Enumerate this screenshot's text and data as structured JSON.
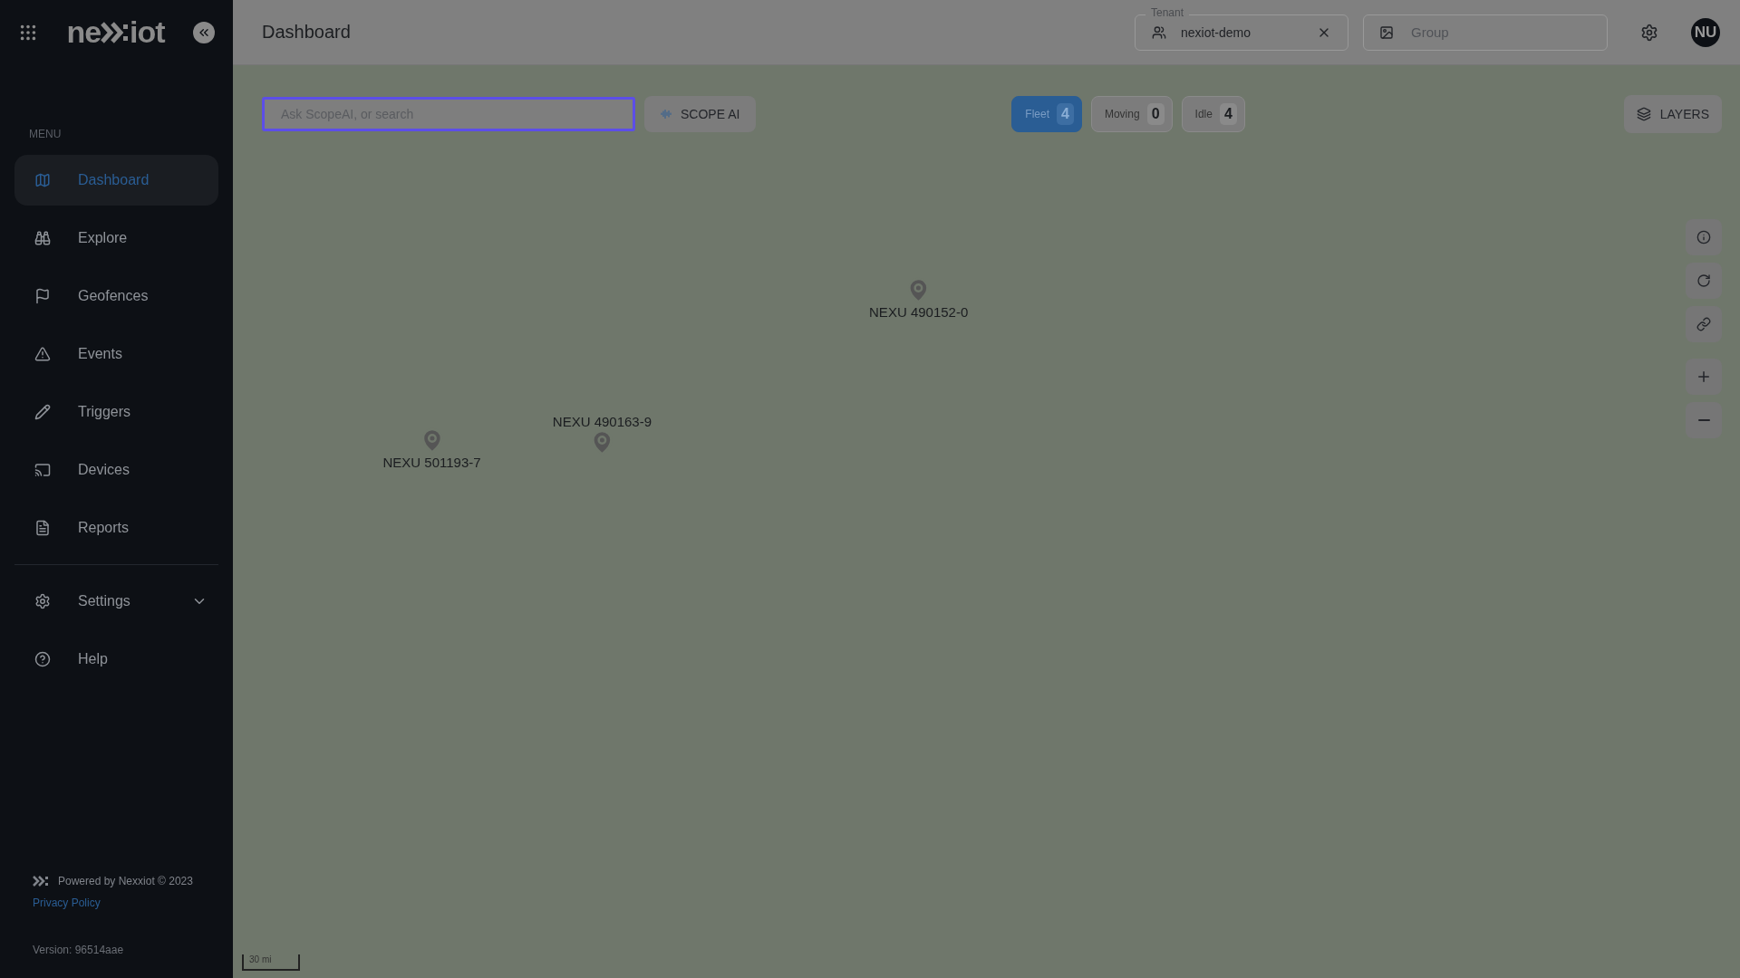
{
  "logo": {
    "start": "ne",
    "end": "iot"
  },
  "sidebar": {
    "menu_label": "MENU",
    "items": [
      {
        "kind": "map",
        "label": "Dashboard",
        "selected": true
      },
      {
        "kind": "binoculars",
        "label": "Explore",
        "selected": false
      },
      {
        "kind": "flag",
        "label": "Geofences",
        "selected": false
      },
      {
        "kind": "alert",
        "label": "Events",
        "selected": false
      },
      {
        "kind": "pencil",
        "label": "Triggers",
        "selected": false
      },
      {
        "kind": "cast",
        "label": "Devices",
        "selected": false
      },
      {
        "kind": "file",
        "label": "Reports",
        "selected": false
      }
    ],
    "bottom_items": [
      {
        "kind": "gear",
        "label": "Settings",
        "expanded": false
      },
      {
        "kind": "help",
        "label": "Help"
      }
    ],
    "footer": {
      "powered": "Powered by Nexxiot © 2023",
      "privacy": "Privacy Policy",
      "version": "Version: 96514aae"
    }
  },
  "header": {
    "title": "Dashboard",
    "tenant": {
      "label": "Tenant",
      "value": "nexiot-demo"
    },
    "group": {
      "placeholder": "Group"
    },
    "avatar": "NU"
  },
  "map": {
    "search": {
      "placeholder": "Ask ScopeAI, or search"
    },
    "scope_button": "SCOPE AI",
    "filters": [
      {
        "label": "Fleet",
        "count": "4",
        "selected": true
      },
      {
        "label": "Moving",
        "count": "0",
        "selected": false
      },
      {
        "label": "Idle",
        "count": "4",
        "selected": false
      }
    ],
    "layers": "LAYERS",
    "markers": [
      {
        "label": "NEXU 490152-0"
      },
      {
        "label": "NEXU 490163-9"
      },
      {
        "label": "NEXU 501193-7"
      }
    ],
    "scale": "30 mi"
  }
}
